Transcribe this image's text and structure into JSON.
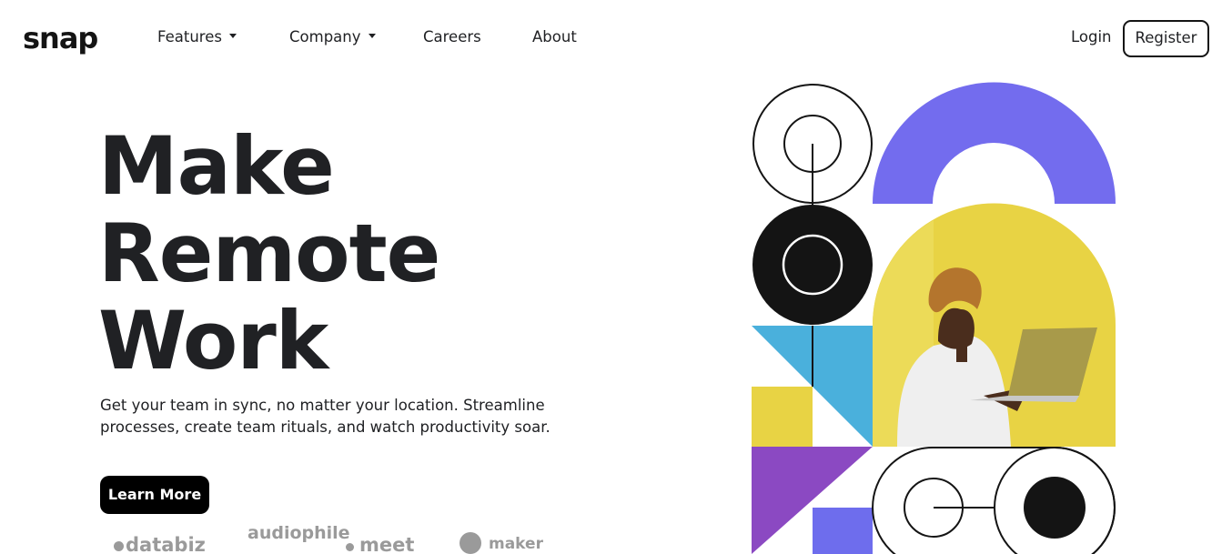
{
  "brand": {
    "logo": "snap"
  },
  "nav": {
    "items": [
      {
        "label": "Features",
        "has_dropdown": true
      },
      {
        "label": "Company",
        "has_dropdown": true
      },
      {
        "label": "Careers",
        "has_dropdown": false
      },
      {
        "label": "About",
        "has_dropdown": false
      }
    ],
    "login_label": "Login",
    "register_label": "Register"
  },
  "hero": {
    "title_lines": [
      "Make",
      "Remote",
      "Work"
    ],
    "description": "Get your team in sync, no matter your location. Streamline processes, create team rituals, and watch productivity soar.",
    "cta_label": "Learn More"
  },
  "clients": [
    {
      "name": "databiz",
      "icon": "databiz-logo"
    },
    {
      "name": "audiophile",
      "icon": "audiophile-logo"
    },
    {
      "name": "meet",
      "icon": "meet-logo"
    },
    {
      "name": "maker",
      "icon": "maker-logo"
    }
  ],
  "colors": {
    "dark": "#141414",
    "purple": "#736cee",
    "yellow": "#e8d344",
    "blue": "#4ab0dc",
    "violet": "#8b49c2",
    "light_blue": "#6e6ded",
    "logo_gray": "#9a9a9a"
  },
  "illustration": {
    "name": "hero-illustration"
  }
}
